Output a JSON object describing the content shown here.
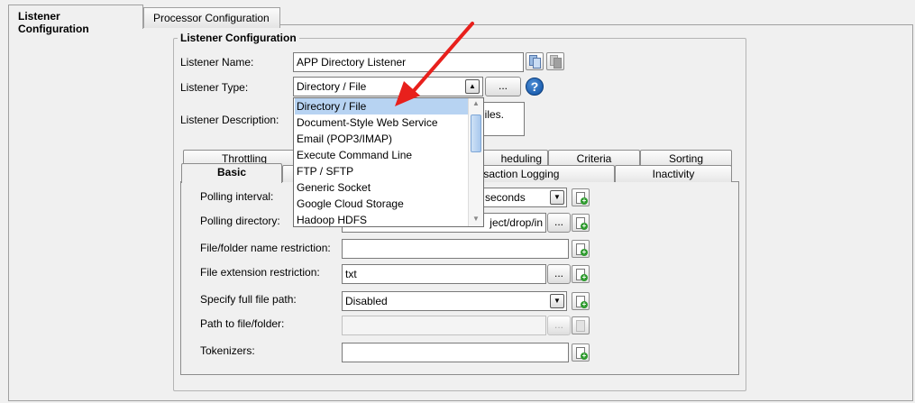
{
  "tabs": [
    {
      "label": "Listener Configuration"
    },
    {
      "label": "Processor Configuration"
    }
  ],
  "section_title": "Listener Configuration",
  "listener_name": {
    "label": "Listener Name:",
    "value": "APP Directory Listener"
  },
  "listener_type": {
    "label": "Listener Type:",
    "value": "Directory / File",
    "dots": "..."
  },
  "listener_description": {
    "label": "Listener Description:",
    "value_visible": "iles."
  },
  "help_glyph": "?",
  "dropdown": {
    "options": [
      "Directory / File",
      "Document-Style Web Service",
      "Email (POP3/IMAP)",
      "Execute Command Line",
      "FTP / SFTP",
      "Generic Socket",
      "Google Cloud Storage",
      "Hadoop HDFS"
    ],
    "selected_index": 0
  },
  "subtabs_back": [
    {
      "label": "Throttling"
    },
    {
      "label": "heduling"
    },
    {
      "label": "Criteria"
    },
    {
      "label": "Sorting"
    }
  ],
  "subtabs_front": [
    {
      "label": "Basic"
    },
    {
      "label": "ansaction Logging"
    },
    {
      "label": "Inactivity"
    }
  ],
  "form": {
    "polling_interval": {
      "label": "Polling interval:",
      "unit": "seconds"
    },
    "polling_directory": {
      "label": "Polling directory:",
      "value_visible": "ject/drop/in",
      "dots": "..."
    },
    "name_restriction": {
      "label": "File/folder name restriction:",
      "value": ""
    },
    "extension_restriction": {
      "label": "File extension restriction:",
      "value": "txt",
      "dots": "..."
    },
    "full_path": {
      "label": "Specify full file path:",
      "value": "Disabled"
    },
    "path_to_file": {
      "label": "Path to file/folder:",
      "value": "",
      "dots": "..."
    },
    "tokenizers": {
      "label": "Tokenizers:",
      "value": ""
    }
  },
  "icons": {
    "arrow_color": "#e8201c",
    "selection_color": "#b7d3f2",
    "help_color": "#0b4ea2"
  }
}
